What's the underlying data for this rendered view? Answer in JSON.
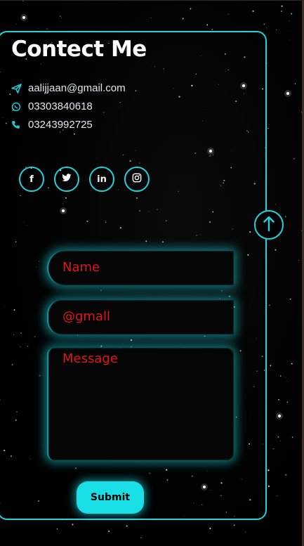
{
  "header": {
    "title": "Contect Me"
  },
  "contacts": [
    {
      "icon": "send-icon",
      "text": "aalijjaan@gmail.com"
    },
    {
      "icon": "whatsapp-icon",
      "text": "03303840618"
    },
    {
      "icon": "phone-icon",
      "text": "03243992725"
    }
  ],
  "social": [
    {
      "icon": "facebook-icon",
      "glyph": "f"
    },
    {
      "icon": "twitter-icon",
      "glyph": ""
    },
    {
      "icon": "linkedin-icon",
      "glyph": "in"
    },
    {
      "icon": "instagram-icon",
      "glyph": ""
    }
  ],
  "form": {
    "name_placeholder": "Name",
    "email_placeholder": "@gmall",
    "message_placeholder": "Message",
    "submit_label": "Submit"
  },
  "colors": {
    "accent": "#1fd3dd",
    "placeholder": "#e0161a",
    "text": "#ffffff",
    "background": "#000000"
  }
}
